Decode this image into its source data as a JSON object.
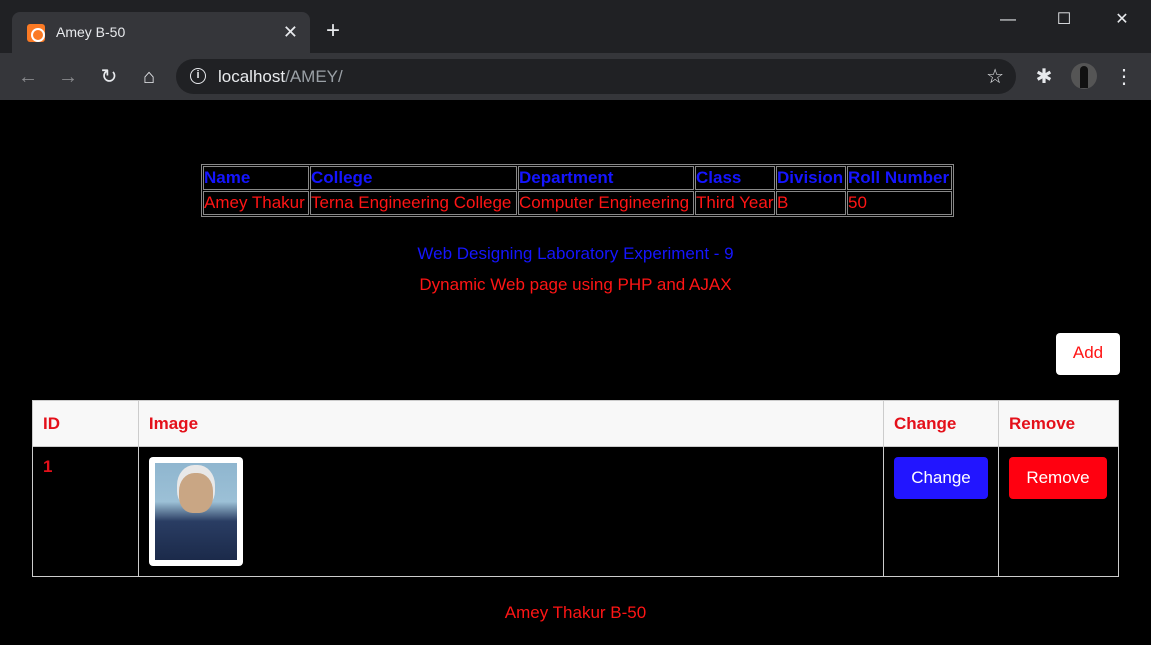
{
  "browser": {
    "tab_title": "Amey B-50",
    "url_host": "localhost",
    "url_path": "/AMEY/"
  },
  "info_table": {
    "headers": [
      "Name",
      "College",
      "Department",
      "Class",
      "Division",
      "Roll Number"
    ],
    "row": [
      "Amey Thakur",
      "Terna Engineering College",
      "Computer Engineering",
      "Third Year",
      "B",
      "50"
    ]
  },
  "experiment": {
    "title": "Web Designing Laboratory Experiment - 9",
    "subtitle": "Dynamic Web page using PHP and AJAX"
  },
  "add_label": "Add",
  "data_table": {
    "headers": [
      "ID",
      "Image",
      "Change",
      "Remove"
    ],
    "rows": [
      {
        "id": "1",
        "change_label": "Change",
        "remove_label": "Remove"
      }
    ]
  },
  "footer": "Amey Thakur B-50"
}
